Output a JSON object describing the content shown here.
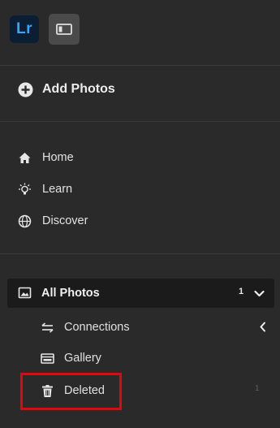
{
  "app": {
    "logo_text": "Lr",
    "accent_color": "#31a8ff",
    "highlight_color": "#e4060a"
  },
  "actions": {
    "add_photos": "Add Photos"
  },
  "nav": {
    "items": [
      {
        "label": "Home",
        "icon": "home-icon"
      },
      {
        "label": "Learn",
        "icon": "lightbulb-icon"
      },
      {
        "label": "Discover",
        "icon": "globe-icon"
      }
    ]
  },
  "library": {
    "all_photos": {
      "label": "All Photos",
      "count": "1"
    },
    "connections": {
      "label": "Connections"
    },
    "gallery": {
      "label": "Gallery"
    },
    "deleted": {
      "label": "Deleted",
      "count": "1"
    }
  }
}
